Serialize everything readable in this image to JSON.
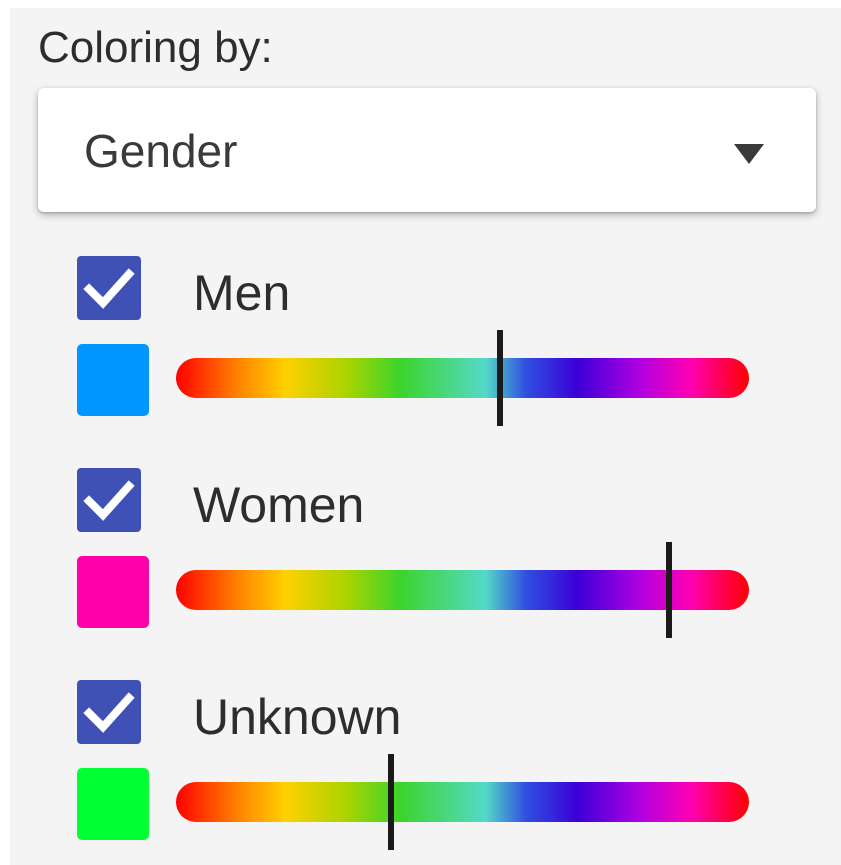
{
  "heading": "Coloring by:",
  "select": {
    "value": "Gender"
  },
  "groups": [
    {
      "label": "Men",
      "checked": true,
      "color": "#0096ff",
      "hue_position": 0.565
    },
    {
      "label": "Women",
      "checked": true,
      "color": "#ff00aa",
      "hue_position": 0.86
    },
    {
      "label": "Unknown",
      "checked": true,
      "color": "#00ff33",
      "hue_position": 0.375
    }
  ],
  "icons": {
    "dropdown": "triangle-down-icon",
    "checkbox": "checkmark-icon"
  },
  "colors": {
    "checkbox": "#3f51b5",
    "panel_background": "#f4f4f4"
  }
}
